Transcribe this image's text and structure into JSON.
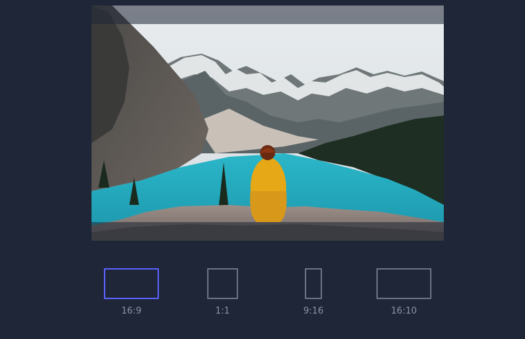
{
  "photo": {
    "description_icon": "landscape-photo"
  },
  "colors": {
    "background": "#1f2637",
    "accent": "#5b63ff",
    "inactive_border": "#6b7385",
    "label_text": "#8c93a3"
  },
  "ratios": [
    {
      "label": "16:9",
      "selected": true
    },
    {
      "label": "1:1",
      "selected": false
    },
    {
      "label": "9:16",
      "selected": false
    },
    {
      "label": "16:10",
      "selected": false
    }
  ]
}
